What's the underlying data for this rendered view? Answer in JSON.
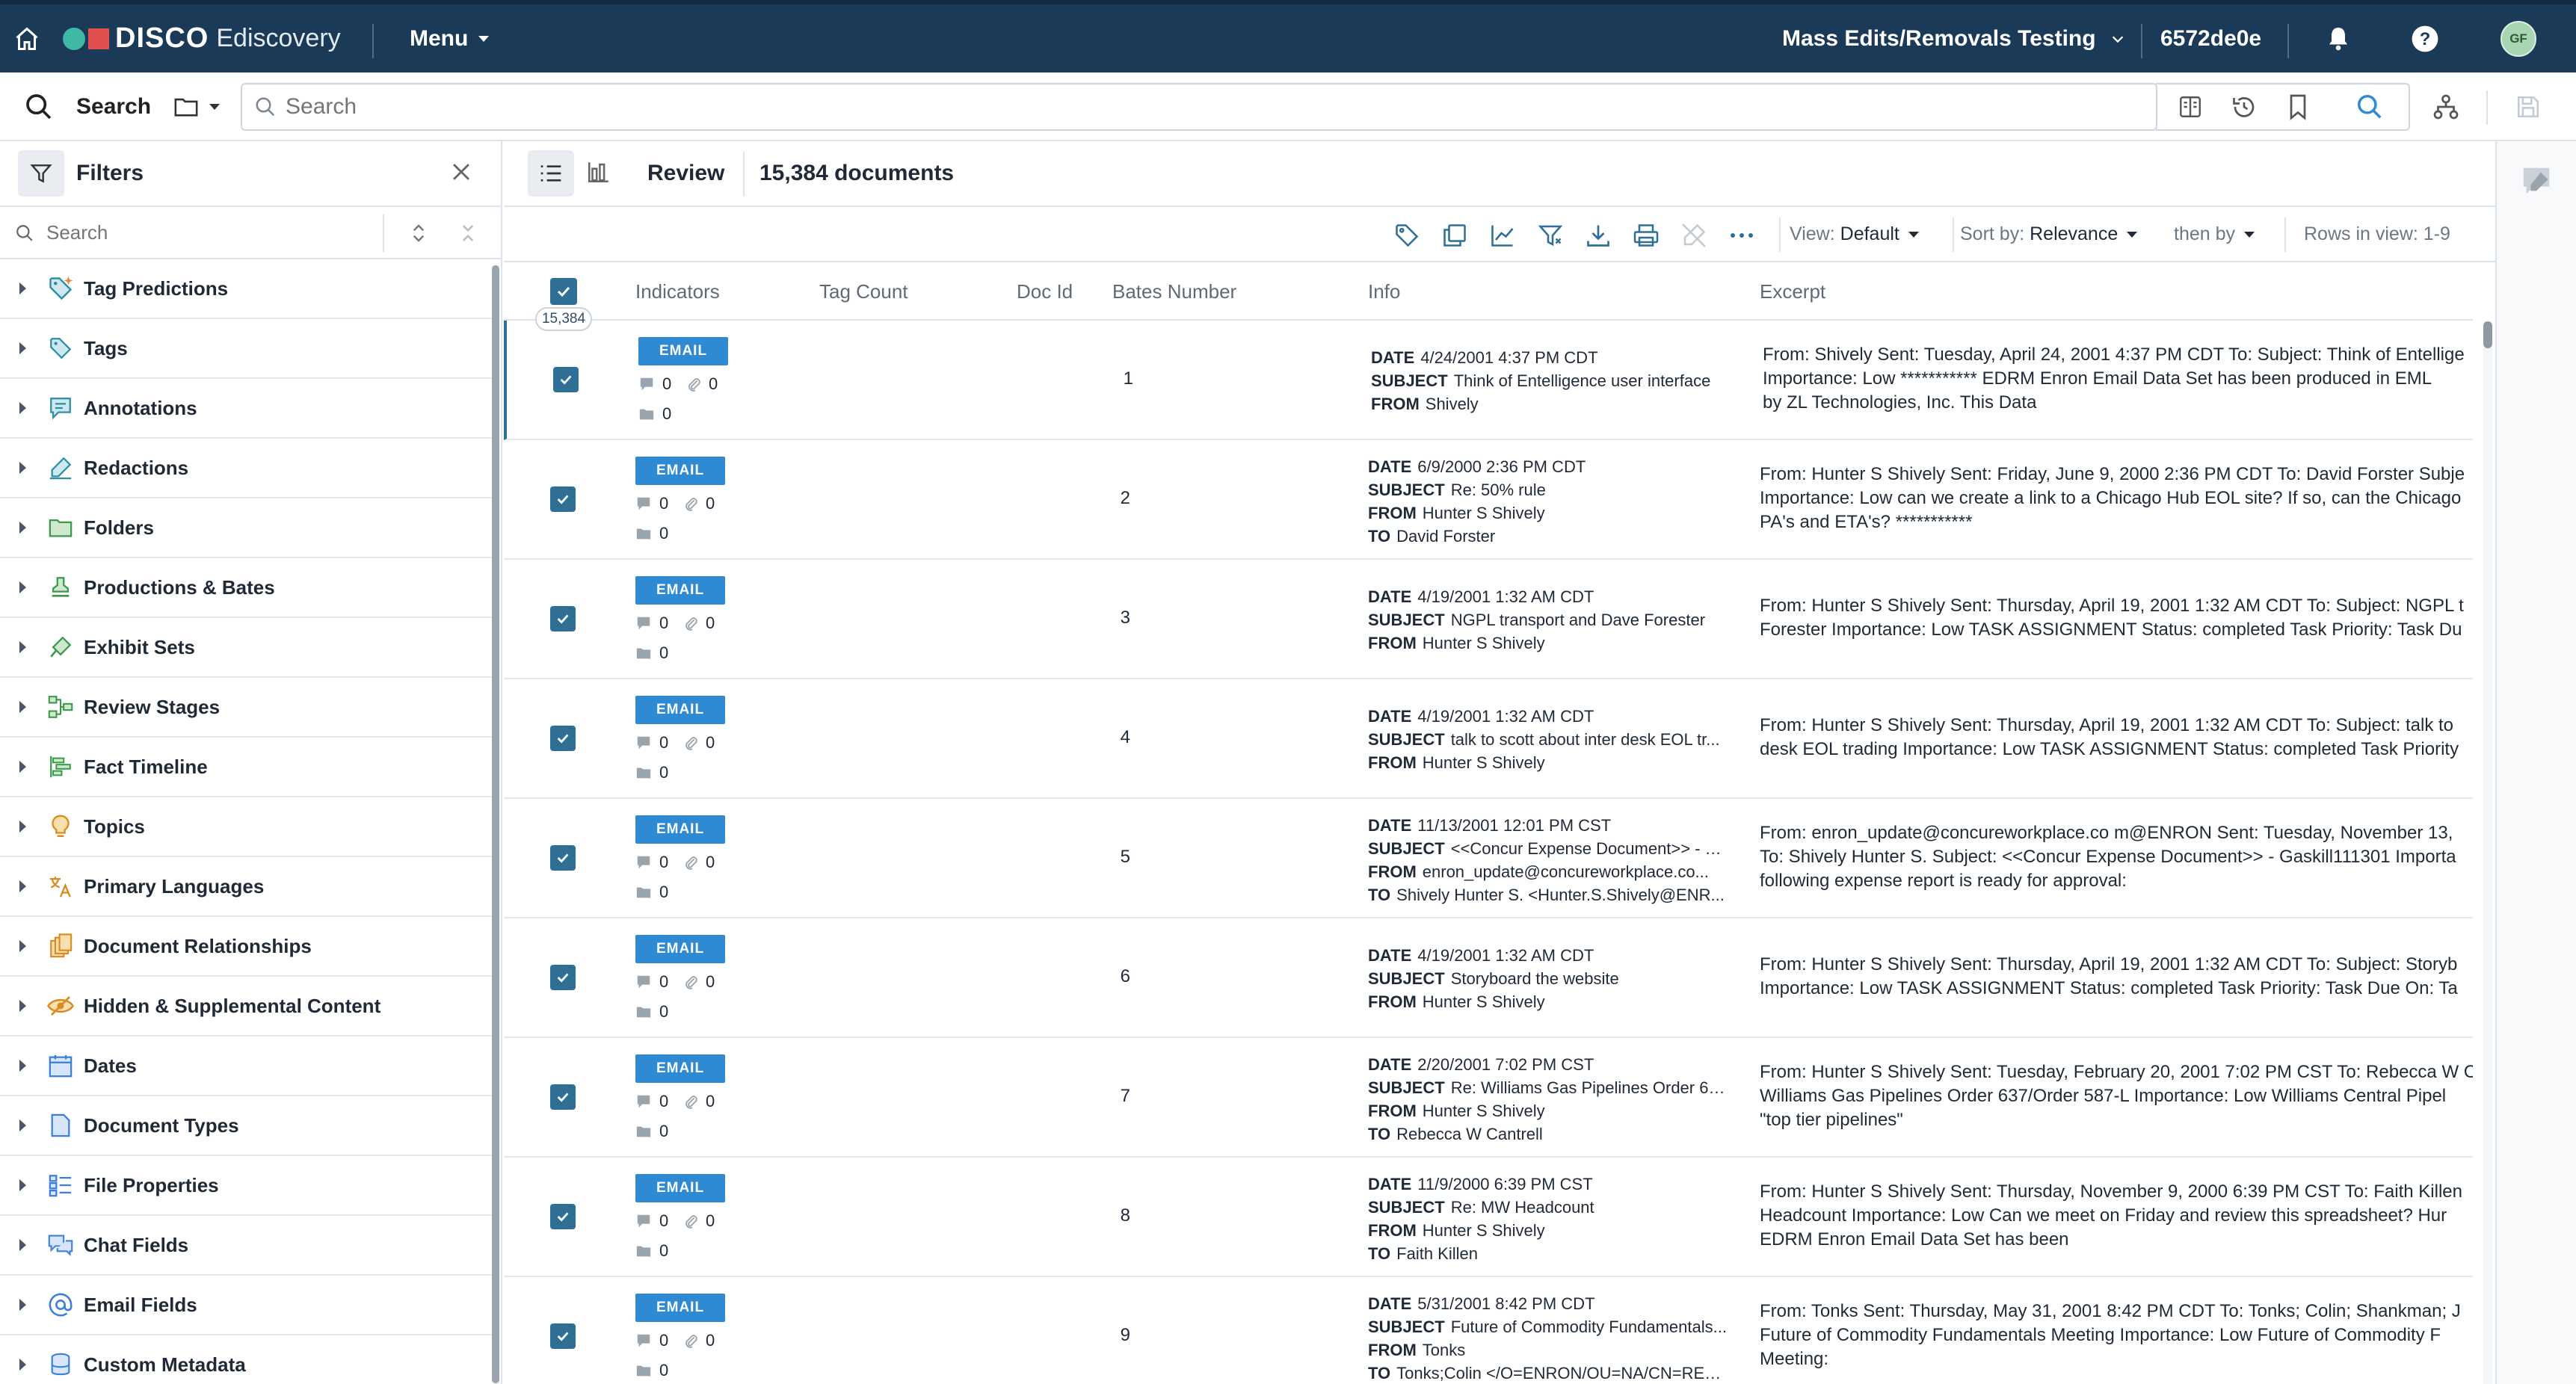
{
  "topbar": {
    "brand": "DISCO",
    "product": "Ediscovery",
    "menu_label": "Menu",
    "workspace": "Mass Edits/Removals Testing",
    "workspace_id": "6572de0e",
    "avatar_initials": "GF",
    "colors": {
      "bar": "#1b3a57",
      "logo_dot": "#3fb8a6",
      "logo_square": "#e2504d"
    }
  },
  "search": {
    "label": "Search",
    "placeholder": "Search"
  },
  "filters": {
    "title": "Filters",
    "search_placeholder": "Search",
    "items": [
      {
        "label": "Tag Predictions",
        "icon": "tag-sparkle-icon"
      },
      {
        "label": "Tags",
        "icon": "tag-icon"
      },
      {
        "label": "Annotations",
        "icon": "annotation-icon"
      },
      {
        "label": "Redactions",
        "icon": "redaction-icon"
      },
      {
        "label": "Folders",
        "icon": "folder-icon"
      },
      {
        "label": "Productions & Bates",
        "icon": "stamp-icon"
      },
      {
        "label": "Exhibit Sets",
        "icon": "exhibit-icon"
      },
      {
        "label": "Review Stages",
        "icon": "stages-icon"
      },
      {
        "label": "Fact Timeline",
        "icon": "timeline-icon"
      },
      {
        "label": "Topics",
        "icon": "bulb-icon"
      },
      {
        "label": "Primary Languages",
        "icon": "language-icon"
      },
      {
        "label": "Document Relationships",
        "icon": "relationships-icon"
      },
      {
        "label": "Hidden & Supplemental Content",
        "icon": "hidden-icon"
      },
      {
        "label": "Dates",
        "icon": "calendar-icon"
      },
      {
        "label": "Document Types",
        "icon": "doc-type-icon"
      },
      {
        "label": "File Properties",
        "icon": "file-properties-icon"
      },
      {
        "label": "Chat Fields",
        "icon": "chat-icon"
      },
      {
        "label": "Email Fields",
        "icon": "at-icon"
      },
      {
        "label": "Custom Metadata",
        "icon": "database-icon"
      }
    ]
  },
  "viewbar": {
    "mode_label": "Review",
    "doc_count": "15,384 documents"
  },
  "toolbar": {
    "view_label": "View:",
    "view_value": "Default",
    "sort_label": "Sort by:",
    "sort_value": "Relevance",
    "then_by": "then by",
    "rows_in_view": "Rows in view: 1-9"
  },
  "table": {
    "selected_count": "15,384",
    "columns": [
      "Indicators",
      "Tag Count",
      "Doc Id",
      "Bates Number",
      "Info",
      "Excerpt"
    ],
    "badge": "EMAIL",
    "info_keys": {
      "date": "DATE",
      "subject": "SUBJECT",
      "from": "FROM",
      "to": "TO"
    },
    "rows": [
      {
        "doc_id": "1",
        "notes": "0",
        "attachments": "0",
        "folders": "0",
        "date": "4/24/2001 4:37 PM CDT",
        "subject": "Think of Entelligence user interface",
        "from": "Shively",
        "to": "",
        "excerpt": [
          "From: Shively Sent: Tuesday, April 24, 2001 4:37 PM CDT To: Subject: Think of Entellige",
          "Importance: Low *********** EDRM Enron Email Data Set has been produced in EML",
          "by ZL Technologies, Inc. This Data"
        ]
      },
      {
        "doc_id": "2",
        "notes": "0",
        "attachments": "0",
        "folders": "0",
        "date": "6/9/2000 2:36 PM CDT",
        "subject": "Re: 50% rule",
        "from": "Hunter S Shively",
        "to": "David Forster",
        "excerpt": [
          "From: Hunter S Shively Sent: Friday, June 9, 2000 2:36 PM CDT To: David Forster Subje",
          "Importance: Low can we create a link to a Chicago Hub EOL site? If so, can the Chicago",
          "PA's and ETA's? ***********"
        ]
      },
      {
        "doc_id": "3",
        "notes": "0",
        "attachments": "0",
        "folders": "0",
        "date": "4/19/2001 1:32 AM CDT",
        "subject": "NGPL transport and Dave Forester",
        "from": "Hunter S Shively",
        "to": "",
        "excerpt": [
          "From: Hunter S Shively Sent: Thursday, April 19, 2001 1:32 AM CDT To: Subject: NGPL t",
          "Forester Importance: Low TASK ASSIGNMENT Status: completed Task Priority: Task Du"
        ]
      },
      {
        "doc_id": "4",
        "notes": "0",
        "attachments": "0",
        "folders": "0",
        "date": "4/19/2001 1:32 AM CDT",
        "subject": "talk to scott about inter desk EOL tr...",
        "from": "Hunter S Shively",
        "to": "",
        "excerpt": [
          "From: Hunter S Shively Sent: Thursday, April 19, 2001 1:32 AM CDT To: Subject: talk to",
          "desk EOL trading Importance: Low TASK ASSIGNMENT Status: completed Task Priority"
        ]
      },
      {
        "doc_id": "5",
        "notes": "0",
        "attachments": "0",
        "folders": "0",
        "date": "11/13/2001 12:01 PM CST",
        "subject": "<<Concur Expense Document>> - G...",
        "from": "enron_update@concureworkplace.co...",
        "to": "Shively Hunter S. <Hunter.S.Shively@ENR...",
        "excerpt": [
          "From: enron_update@concureworkplace.co m@ENRON Sent: Tuesday, November 13,",
          "To: Shively Hunter S. Subject: <<Concur Expense Document>> - Gaskill111301 Importa",
          "following expense report is ready for approval:"
        ]
      },
      {
        "doc_id": "6",
        "notes": "0",
        "attachments": "0",
        "folders": "0",
        "date": "4/19/2001 1:32 AM CDT",
        "subject": "Storyboard the website",
        "from": "Hunter S Shively",
        "to": "",
        "excerpt": [
          "From: Hunter S Shively Sent: Thursday, April 19, 2001 1:32 AM CDT To: Subject: Storyb",
          "Importance: Low TASK ASSIGNMENT Status: completed Task Priority: Task Due On: Ta"
        ]
      },
      {
        "doc_id": "7",
        "notes": "0",
        "attachments": "0",
        "folders": "0",
        "date": "2/20/2001 7:02 PM CST",
        "subject": "Re: Williams Gas Pipelines Order 63...",
        "from": "Hunter S Shively",
        "to": "Rebecca W Cantrell",
        "excerpt": [
          "From: Hunter S Shively Sent: Tuesday, February 20, 2001 7:02 PM CST To: Rebecca W C",
          "Williams Gas Pipelines Order 637/Order 587-L Importance: Low Williams Central Pipel",
          "\"top tier pipelines\""
        ]
      },
      {
        "doc_id": "8",
        "notes": "0",
        "attachments": "0",
        "folders": "0",
        "date": "11/9/2000 6:39 PM CST",
        "subject": "Re: MW Headcount",
        "from": "Hunter S Shively",
        "to": "Faith Killen",
        "excerpt": [
          "From: Hunter S Shively Sent: Thursday, November 9, 2000 6:39 PM CST To: Faith Killen",
          "Headcount Importance: Low Can we meet on Friday and review this spreadsheet? Hur",
          "EDRM Enron Email Data Set has been"
        ]
      },
      {
        "doc_id": "9",
        "notes": "0",
        "attachments": "0",
        "folders": "0",
        "date": "5/31/2001 8:42 PM CDT",
        "subject": "Future of Commodity Fundamentals...",
        "from": "Tonks",
        "to": "Tonks;Colin </O=ENRON/OU=NA/CN=REC...",
        "excerpt": [
          "From: Tonks Sent: Thursday, May 31, 2001 8:42 PM CDT To: Tonks; Colin; Shankman; J",
          "Future of Commodity Fundamentals Meeting Importance: Low Future of Commodity F",
          "Meeting:"
        ]
      }
    ]
  }
}
